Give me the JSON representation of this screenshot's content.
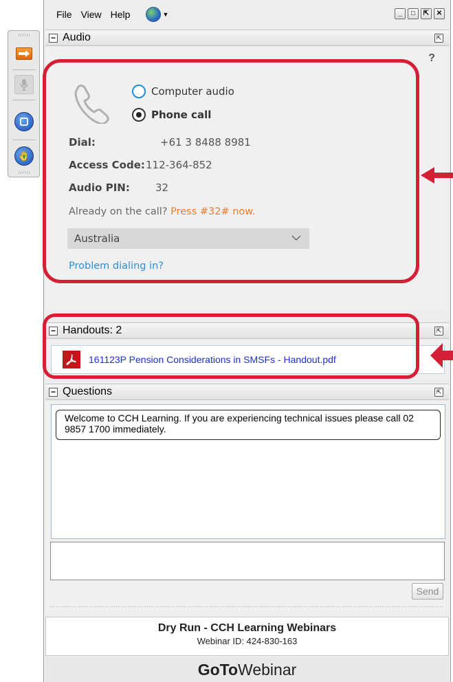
{
  "menu": {
    "items": [
      "File",
      "View",
      "Help"
    ],
    "language_icon": "globe-icon",
    "window_controls": [
      "minimize",
      "maximize",
      "popout",
      "close"
    ]
  },
  "toolbar": {
    "icons": [
      "show-hide-panel-arrow-icon",
      "microphone-icon",
      "screen-icon",
      "raise-hand-icon"
    ]
  },
  "audio": {
    "title": "Audio",
    "help": "?",
    "options": [
      {
        "label": "Computer audio",
        "selected": false
      },
      {
        "label": "Phone call",
        "selected": true
      }
    ],
    "dial_label": "Dial:",
    "dial_value": "+61 3 8488 8981",
    "access_label": "Access Code:",
    "access_value": "112-364-852",
    "pin_label": "Audio PIN:",
    "pin_value": "32",
    "already": "Already on the call?",
    "press": "Press #32# now.",
    "country": "Australia",
    "problem": "Problem dialing in?"
  },
  "handouts": {
    "title": "Handouts: 2",
    "items": [
      "161123P Pension Considerations in SMSFs - Handout.pdf"
    ]
  },
  "questions": {
    "title": "Questions",
    "messages": [
      "Welcome to CCH Learning. If you are experiencing technical issues please call 02 9857 1700 immediately."
    ],
    "send_label": "Send"
  },
  "footer": {
    "title": "Dry Run - CCH Learning Webinars",
    "webinar_id": "Webinar ID: 424-830-163",
    "brand_bold": "GoTo",
    "brand_light": "Webinar"
  },
  "colors": {
    "annotation": "#d41f35",
    "link": "#2b8fd8",
    "press": "#f07a2a",
    "handout_link": "#1b2fd6"
  }
}
